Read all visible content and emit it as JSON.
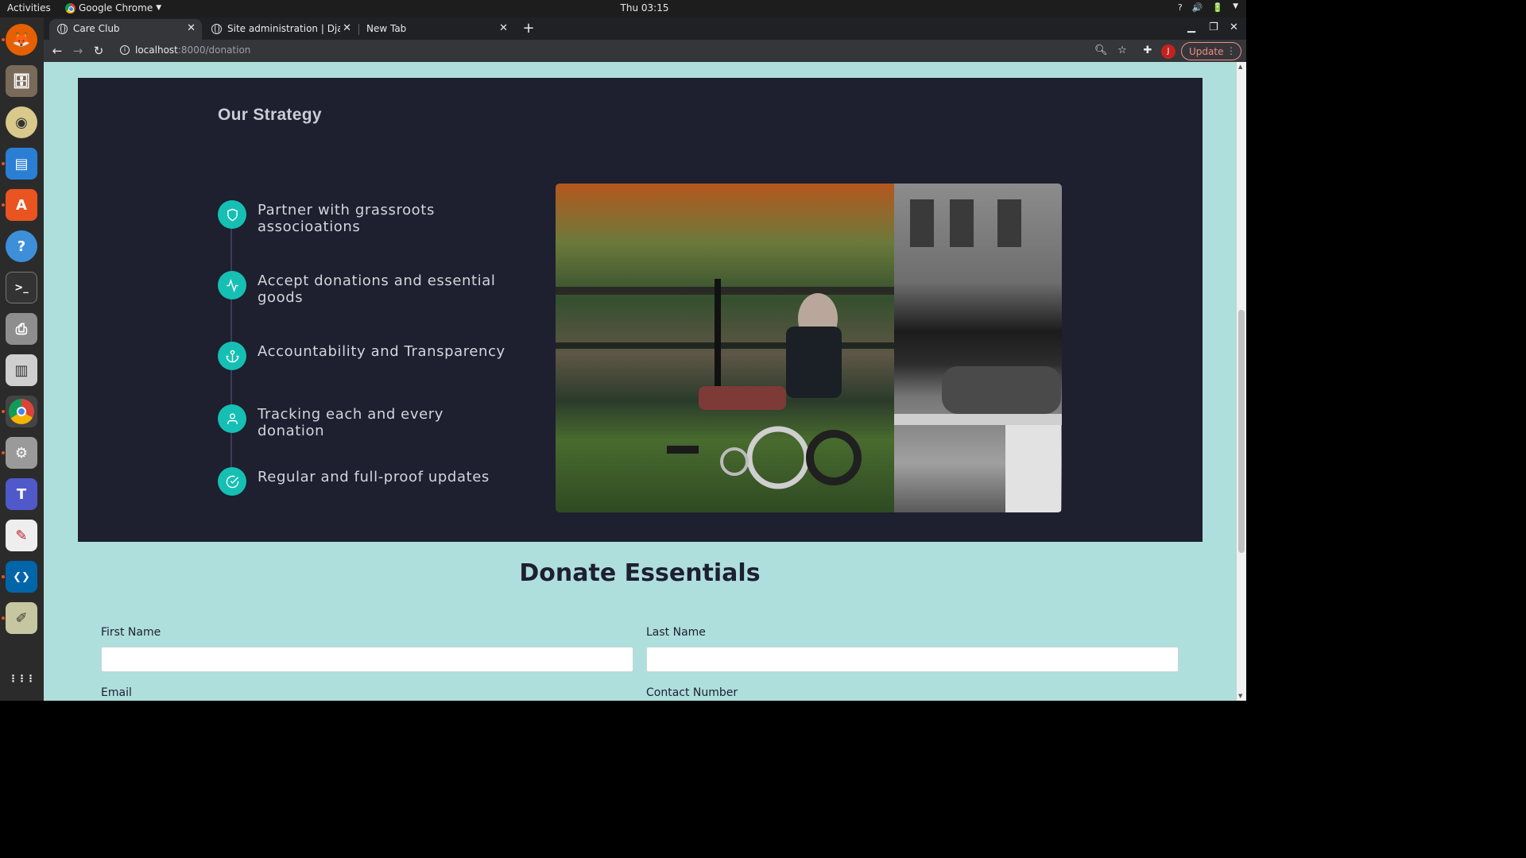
{
  "system": {
    "activities": "Activities",
    "app_name": "Google Chrome",
    "clock": "Thu 03:15",
    "tray_help": "?",
    "tray_volume": "🔊",
    "tray_power": "🔋"
  },
  "dock": {
    "items": [
      {
        "name": "firefox",
        "glyph": "🦊"
      },
      {
        "name": "files",
        "glyph": "🗄"
      },
      {
        "name": "rhythmbox",
        "glyph": "◉"
      },
      {
        "name": "writer",
        "glyph": "▤"
      },
      {
        "name": "software",
        "glyph": "A"
      },
      {
        "name": "help",
        "glyph": "?"
      },
      {
        "name": "terminal",
        "glyph": ">_"
      },
      {
        "name": "printer",
        "glyph": "⎙"
      },
      {
        "name": "mixer",
        "glyph": "▥"
      },
      {
        "name": "chrome",
        "glyph": "●"
      },
      {
        "name": "settings",
        "glyph": "⚙"
      },
      {
        "name": "teams",
        "glyph": "T"
      },
      {
        "name": "edit",
        "glyph": "✎"
      },
      {
        "name": "vscode",
        "glyph": "❮❯"
      },
      {
        "name": "drawing",
        "glyph": "✐"
      },
      {
        "name": "app-grid",
        "glyph": "⋮⋮⋮"
      }
    ]
  },
  "browser": {
    "tabs": [
      {
        "title": "Care Club",
        "close": "✕"
      },
      {
        "title": "Site administration | Django site admin",
        "close": "✕"
      },
      {
        "title": "New Tab",
        "close": "✕"
      }
    ],
    "new_tab": "+",
    "url_host": "localhost",
    "url_path": ":8000/donation",
    "update_label": "Update",
    "profile_initial": "J"
  },
  "strategy": {
    "title": "Our Strategy",
    "steps": [
      {
        "label": "Partner with grassroots associoations",
        "icon": "shield-icon"
      },
      {
        "label": "Accept donations and essential goods",
        "icon": "activity-icon"
      },
      {
        "label": "Accountability and Transparency",
        "icon": "anchor-icon"
      },
      {
        "label": "Tracking each and every donation",
        "icon": "user-icon"
      },
      {
        "label": "Regular and full-proof updates",
        "icon": "check-circle-icon"
      }
    ]
  },
  "donate": {
    "title": "Donate Essentials",
    "first_name_label": "First Name",
    "last_name_label": "Last Name",
    "email_label": "Email",
    "contact_label": "Contact Number",
    "first_name_value": "",
    "last_name_value": ""
  },
  "colors": {
    "page_bg": "#aedfdc",
    "panel_bg": "#1e1f2f",
    "accent": "#16bfb3"
  }
}
